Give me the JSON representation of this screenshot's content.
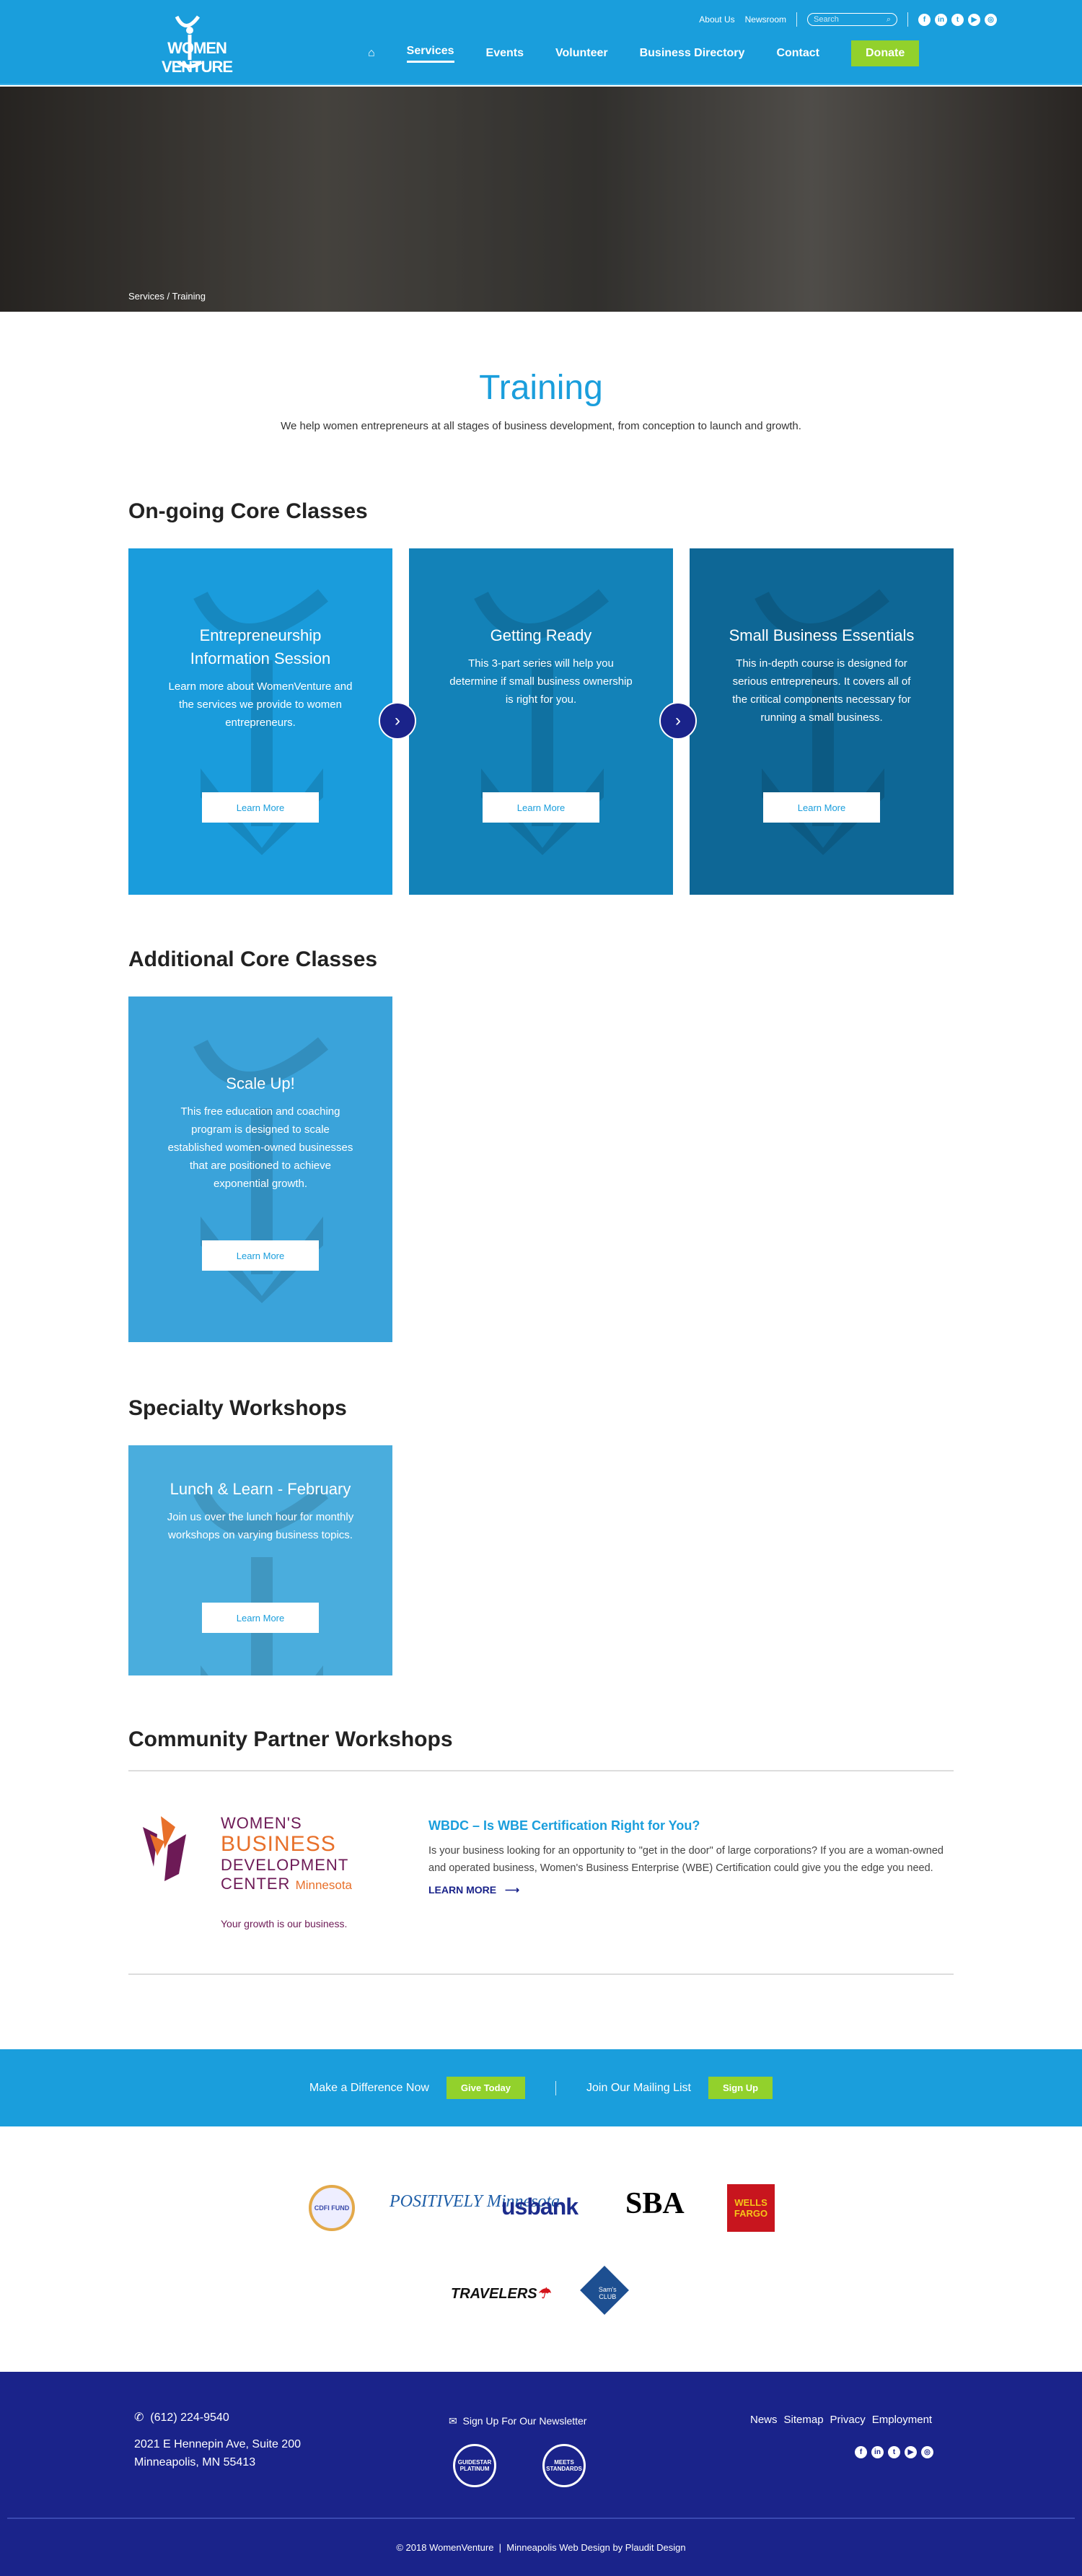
{
  "header": {
    "logo_text": "WOMEN VENTURE",
    "top_links": [
      "About Us",
      "Newsroom"
    ],
    "search_placeholder": "Search",
    "social": [
      "facebook",
      "linkedin",
      "twitter",
      "youtube",
      "instagram"
    ],
    "nav": [
      "Services",
      "Events",
      "Volunteer",
      "Business Directory",
      "Contact"
    ],
    "donate": "Donate"
  },
  "breadcrumb": [
    "Services",
    "/",
    "Training"
  ],
  "page": {
    "title": "Training",
    "intro": "We help women entrepreneurs at all stages of business development, from conception to launch and growth."
  },
  "sections": {
    "ongoing": "On-going Core Classes",
    "additional": "Additional Core Classes",
    "specialty": "Specialty Workshops",
    "community": "Community Partner Workshops"
  },
  "cards": [
    {
      "title": "Entrepreneurship Information Session",
      "text": "Learn more about WomenVenture and the services we provide to women entrepreneurs.",
      "button": "Learn More",
      "color": "#1a9cdc"
    },
    {
      "title": "Getting Ready",
      "text": "This 3-part series will help you determine if small business ownership is right for you.",
      "button": "Learn More",
      "color": "#1382b8"
    },
    {
      "title": "Small Business Essentials",
      "text": "This in-depth course is designed for serious entrepreneurs. It covers all of the critical components necessary for running a small business.",
      "button": "Learn More",
      "color": "#0e6796"
    },
    {
      "title": "Scale Up!",
      "text": "This free education and coaching program is designed to scale established women-owned businesses that are positioned to achieve exponential growth.",
      "button": "Learn More",
      "color": "#3aa3da"
    },
    {
      "title": "Lunch & Learn - February",
      "text": "Join us over the lunch hour for monthly workshops on varying business topics.",
      "button": "Learn More",
      "color": "#4aaddd"
    }
  ],
  "partner": {
    "logo_lines": [
      "WOMEN'S",
      "BUSINESS",
      "DEVELOPMENT",
      "CENTER",
      "Minnesota"
    ],
    "logo_tagline": "Your growth is our business.",
    "title": "WBDC – Is WBE Certification Right for You?",
    "text": "Is your business looking for an opportunity to \"get in the door\" of large corporations? If you are a woman-owned and operated business, Women's Business Enterprise (WBE) Certification could give you the edge you need.",
    "link": "LEARN MORE",
    "arrow": "⟶"
  },
  "cta": {
    "give_label": "Make a Difference Now",
    "give_button": "Give Today",
    "mail_label": "Join Our Mailing List",
    "mail_button": "Sign Up"
  },
  "sponsors": [
    "CDFI FUND",
    "POSITIVELY Minnesota",
    "usbank",
    "SBA",
    "WELLS FARGO",
    "TRAVELERS",
    "Sam's CLUB"
  ],
  "footer": {
    "phone": "(612) 224-9540",
    "address1": "2021 E Hennepin Ave, Suite 200",
    "address2": "Minneapolis, MN 55413",
    "newsletter": "Sign Up For Our Newsletter",
    "badges": [
      "GUIDESTAR PLATINUM",
      "MEETS STANDARDS"
    ],
    "links": [
      "News",
      "Sitemap",
      "Privacy",
      "Employment"
    ],
    "copyright": "© 2018 WomenVenture  |  Minneapolis Web Design by Plaudit Design"
  }
}
